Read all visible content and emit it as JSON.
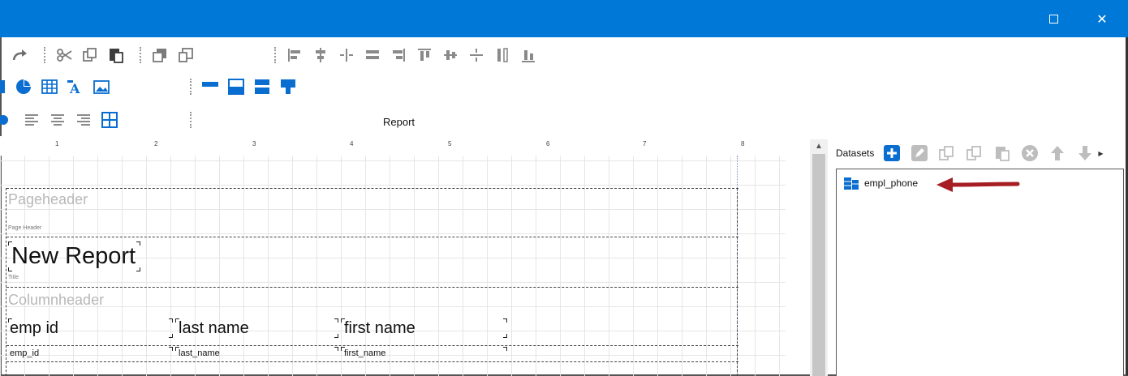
{
  "window": {
    "maximize_icon": "maximize-icon",
    "close_glyph": "✕"
  },
  "toolbar": {
    "row1_icons": [
      "redo-icon",
      "cut-icon",
      "copy-icon",
      "paste-icon",
      "bring-front-icon",
      "send-back-icon",
      "align-left-icon",
      "align-center-icon",
      "align-middle-icon",
      "align-distribute-icon",
      "align-right-icon",
      "align-top-icon",
      "align-vcenter-icon",
      "align-hcenter-icon",
      "same-height-icon",
      "align-bottom-icon"
    ],
    "row2_icons": [
      "chart-icon",
      "pie-chart-icon",
      "table-icon",
      "text-icon",
      "image-icon",
      "band-top-icon",
      "band-header-icon",
      "band-detail-icon",
      "band-group-icon"
    ],
    "row3_icons": [
      "record-icon",
      "text-align-left-icon",
      "text-align-center-icon",
      "text-align-right-icon",
      "grid-icon"
    ],
    "report_label": "Report"
  },
  "ruler": {
    "numbers": [
      "1",
      "2",
      "3",
      "4",
      "5",
      "6",
      "7",
      "8"
    ]
  },
  "design": {
    "pageheader_band": "Pageheader",
    "pageheader_small": "Page Header",
    "title_text": "New Report",
    "title_small": "Title",
    "columnheader_band": "Columnheader",
    "columns": [
      {
        "header": "emp id",
        "detail": "emp_id"
      },
      {
        "header": "last name",
        "detail": "last_name"
      },
      {
        "header": "first name",
        "detail": "first_name"
      }
    ]
  },
  "datasets": {
    "label": "Datasets",
    "buttons": [
      "add-icon",
      "edit-icon",
      "copy-icon",
      "duplicate-icon",
      "paste-icon",
      "delete-icon",
      "move-up-icon",
      "move-down-icon"
    ],
    "items": [
      "empl_phone"
    ]
  },
  "colors": {
    "titlebar": "#0078d7",
    "accent_blue": "#0a6ed1",
    "arrow_red": "#a61e24"
  }
}
